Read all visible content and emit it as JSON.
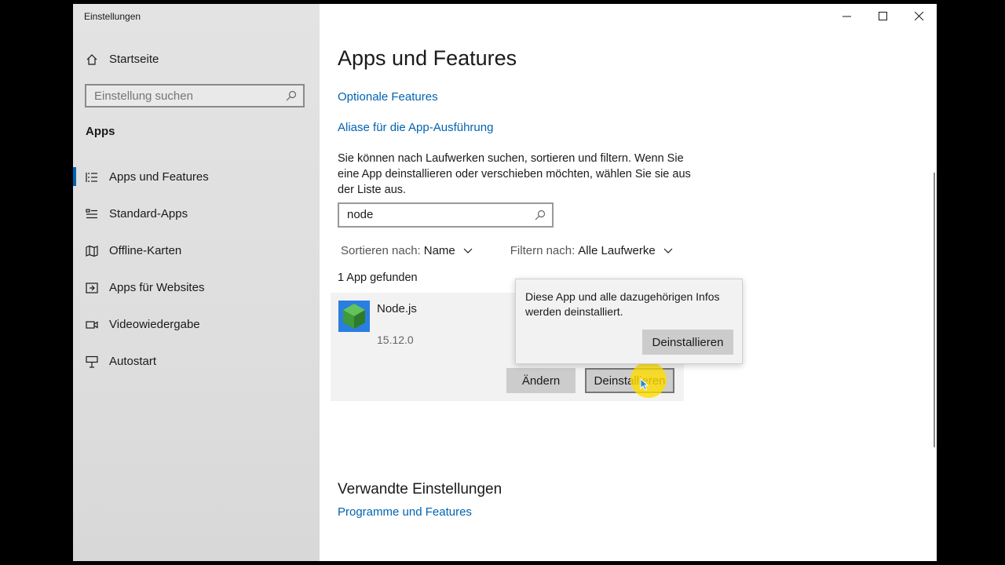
{
  "window": {
    "title": "Einstellungen"
  },
  "sidebar": {
    "home_label": "Startseite",
    "search_placeholder": "Einstellung suchen",
    "section_label": "Apps",
    "items": [
      {
        "label": "Apps und Features",
        "icon": "list-icon",
        "active": true
      },
      {
        "label": "Standard-Apps",
        "icon": "default-apps-icon"
      },
      {
        "label": "Offline-Karten",
        "icon": "map-icon"
      },
      {
        "label": "Apps für Websites",
        "icon": "website-apps-icon"
      },
      {
        "label": "Videowiedergabe",
        "icon": "video-icon"
      },
      {
        "label": "Autostart",
        "icon": "startup-icon"
      }
    ]
  },
  "main": {
    "title": "Apps und Features",
    "link_optional": "Optionale Features",
    "link_alias": "Aliase für die App-Ausführung",
    "description": "Sie können nach Laufwerken suchen, sortieren und filtern. Wenn Sie eine App deinstallieren oder verschieben möchten, wählen Sie sie aus der Liste aus.",
    "search_value": "node",
    "sort_label": "Sortieren nach:",
    "sort_value": "Name",
    "filter_label": "Filtern nach:",
    "filter_value": "Alle Laufwerke",
    "result_count": "1 App gefunden",
    "app": {
      "name": "Node.js",
      "version": "15.12.0",
      "change_label": "Ändern",
      "uninstall_label": "Deinstallieren"
    },
    "popup": {
      "text": "Diese App und alle dazugehörigen Infos werden deinstalliert.",
      "button_label": "Deinstallieren"
    },
    "related_title": "Verwandte Einstellungen",
    "related_link": "Programme und Features"
  },
  "colors": {
    "accent": "#0063b1",
    "highlight": "#ffdd00"
  }
}
